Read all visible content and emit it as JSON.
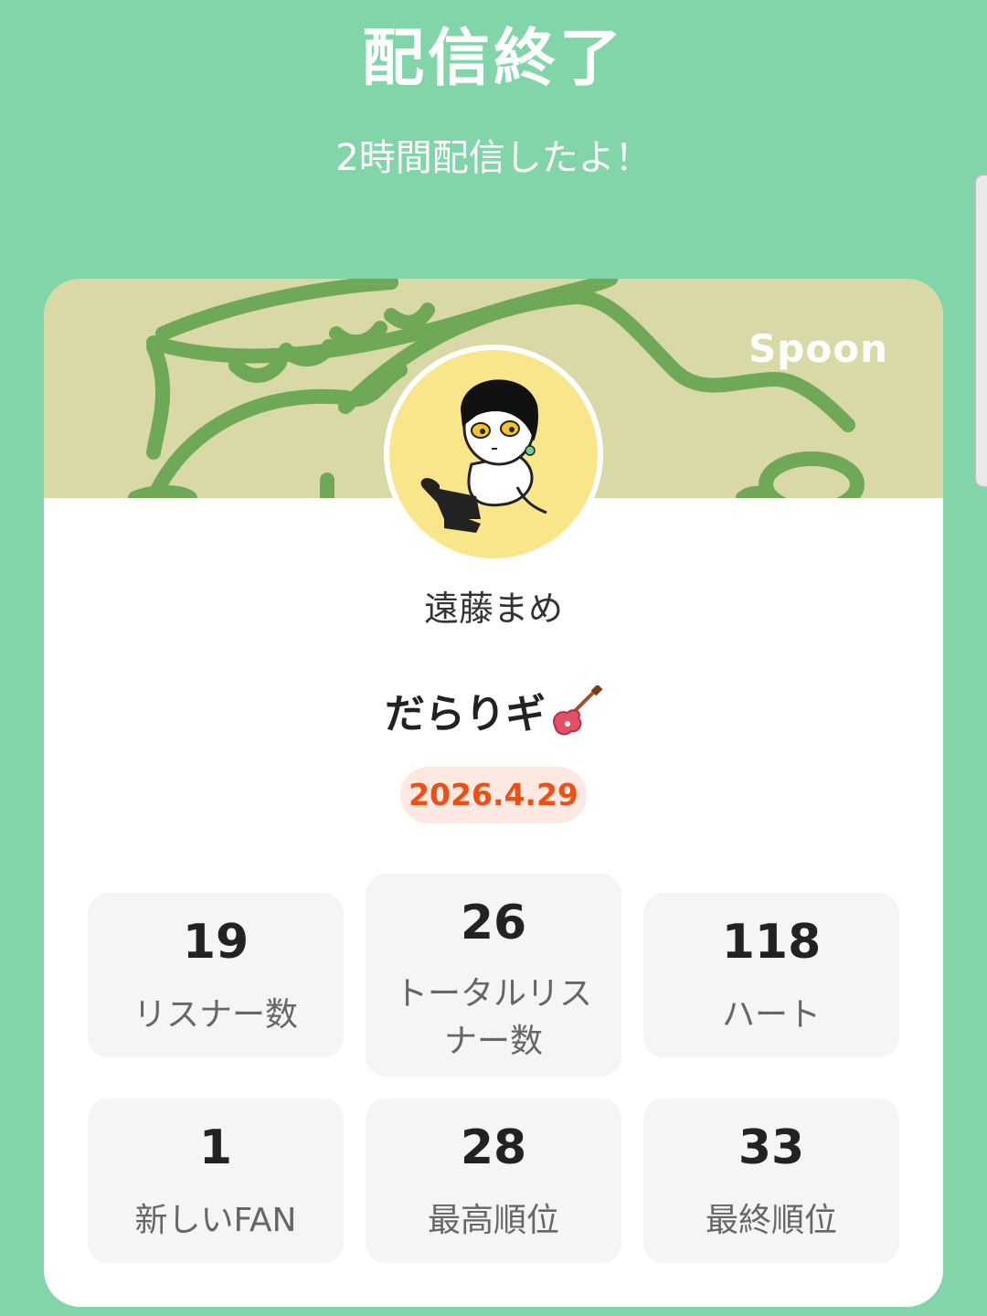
{
  "header": {
    "title": "配信終了",
    "subtitle": "2時間配信したよ！"
  },
  "card": {
    "brand": "Spoon",
    "username": "遠藤まめ",
    "stream_title": "だらりギ",
    "stream_title_icon": "electric-guitar-icon",
    "date": "2026.4.29"
  },
  "stats": [
    {
      "value": "19",
      "label": "リスナー数"
    },
    {
      "value": "26",
      "label": "トータルリスナー数"
    },
    {
      "value": "118",
      "label": "ハート"
    },
    {
      "value": "1",
      "label": "新しいFAN"
    },
    {
      "value": "28",
      "label": "最高順位"
    },
    {
      "value": "33",
      "label": "最終順位"
    }
  ],
  "colors": {
    "background": "#82d5a8",
    "banner": "#d9d8a7",
    "banner_line": "#6fa857",
    "date_text": "#ef4f15",
    "date_bg": "#fde9e2"
  }
}
